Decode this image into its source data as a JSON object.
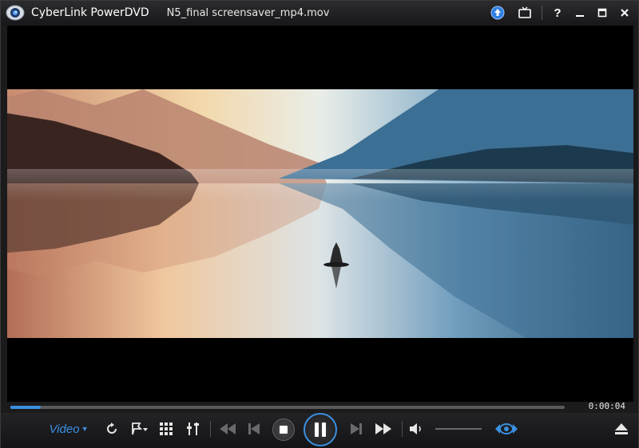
{
  "window": {
    "app_title": "CyberLink PowerDVD",
    "file_title": "N5_final screensaver_mp4.mov"
  },
  "titlebar_icons": [
    "upgrade-icon",
    "tv-mode-icon",
    "help-icon",
    "minimize-icon",
    "maximize-icon",
    "close-icon"
  ],
  "titlebar": {
    "help_label": "?"
  },
  "playback": {
    "elapsed_time": "0:00:04",
    "progress_fraction": 0.055
  },
  "controls": {
    "menu_label": "Video",
    "buttons": [
      "repeat-icon",
      "bookmark-icon",
      "chapters-icon",
      "settings-icon",
      "rewind-icon",
      "previous-icon",
      "stop-icon",
      "pause-icon",
      "next-icon",
      "fast-forward-icon",
      "volume-icon",
      "view-mode-icon",
      "eject-icon"
    ]
  },
  "colors": {
    "accent": "#3b8fe0",
    "titlebar_bg": "#1e1e20",
    "controlbar_bg": "#1a1a1c"
  }
}
